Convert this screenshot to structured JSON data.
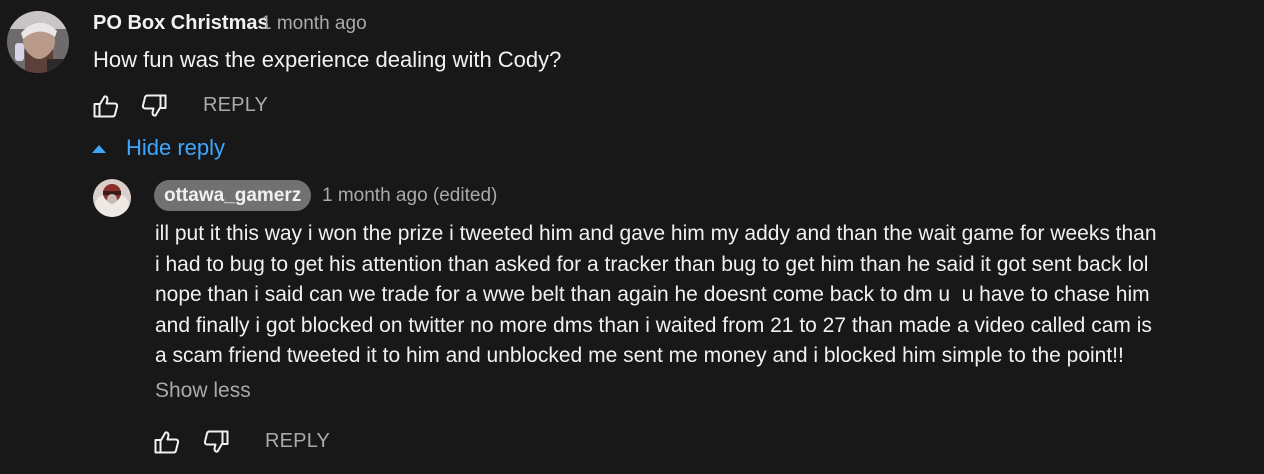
{
  "comment": {
    "author": "PO Box Christmas",
    "time": "1 month ago",
    "text": "How fun was the experience dealing with Cody?",
    "reply_label": "REPLY",
    "like_icon": "thumbs-up-icon",
    "dislike_icon": "thumbs-down-icon"
  },
  "replies_toggle": {
    "label": "Hide reply",
    "icon": "caret-up-icon"
  },
  "reply": {
    "author": "ottawa_gamerz",
    "time": "1 month ago (edited)",
    "lines": [
      "ill put it this way i won the prize i tweeted him and gave him my addy and than the wait game for weeks than",
      "i had to bug to get his attention than asked for a tracker than bug to get him than he said it got sent back lol",
      "nope than i said can we trade for a wwe belt than again he doesnt come back to dm u  u have to chase him",
      "and finally i got blocked on twitter no more dms than i waited from 21 to 27 than made a video called cam is",
      "a scam friend tweeted it to him and unblocked me sent me money and i blocked him simple to the point!!"
    ],
    "show_less_label": "Show less",
    "reply_label": "REPLY"
  },
  "colors": {
    "background": "#181818",
    "text": "#f1f1f1",
    "secondary": "#aaaaaa",
    "link": "#3ea6ff",
    "author_chip": "#717171"
  }
}
